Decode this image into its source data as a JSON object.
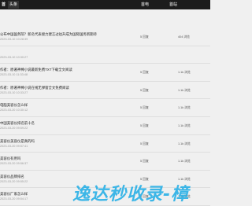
{
  "topbar": {
    "home_label": "首",
    "active_tab": "头条",
    "right_label_1": "首电",
    "right_label_2": "首站"
  },
  "articles": [
    {
      "title": "公布中国国务院？新名代表接力建言过往升成为国际国务新期待",
      "date": "2023-03-10 10:28:39",
      "count": "5 回复",
      "views": "404 浏览"
    },
    {
      "title": "",
      "date": "2023-03-10 10:30:27",
      "count": "",
      "views": ""
    },
    {
      "title": "作者：原著神棒小说最新免费TXT下载全文阅读",
      "date": "2023-03-10 11:33:48",
      "count": "5 回复",
      "views": "1.1k 浏览"
    },
    {
      "title": "作者：原著神棒小说在线无弹窗全文免费阅读",
      "date": "2023-03-10 10:33:27",
      "count": "5 回复",
      "views": "1.1k 浏览"
    },
    {
      "title": "电脑美容仪怎么样",
      "date": "2023-03-20 10:30:12",
      "count": "5 回复",
      "views": "1.1k 浏览"
    },
    {
      "title": "中国美容仪排名前十名",
      "date": "2023-03-20 09:59:22",
      "count": "5 回复",
      "views": "1.1k 浏览"
    },
    {
      "title": "美容仪美容仪是真的吗",
      "date": "2023-03-20 09:57:41",
      "count": "5 回复",
      "views": "1.1k 浏览"
    },
    {
      "title": "美容仪有用吗",
      "date": "2023-03-20 09:56:37",
      "count": "5 回复",
      "views": "1.1k 浏览"
    },
    {
      "title": "美容仪品牌排名",
      "date": "2023-03-20 09:55:22",
      "count": "5 回复",
      "views": "1.1k 浏览"
    },
    {
      "title": "美容仪厂家怎么样",
      "date": "2023-03-20 09:54:17",
      "count": "5 回复",
      "views": "1.1k 浏览"
    },
    {
      "title": "大学士么建一级建筑",
      "date": "2023-03-20 09:52:20",
      "count": "5 回复",
      "views": "1.1k 浏览"
    },
    {
      "title": "大学士么建找建筑设计",
      "date": "2023-03-20 09:50:16",
      "count": "5 回复",
      "views": "1.1k 浏览"
    },
    {
      "title": "美容仪道路设计师种类怎么样",
      "date": "2023-03-20 09:48:12",
      "count": "5 回复",
      "views": "1.1k 浏览"
    },
    {
      "title": "数字经济市场主体视频类新闻资讯：平台方监督无心意招揽资",
      "date": "2023-03-20 09:46:10",
      "count": "5 回复",
      "views": "1.1k 浏览"
    }
  ],
  "watermark": "逸达秒收录-樟"
}
